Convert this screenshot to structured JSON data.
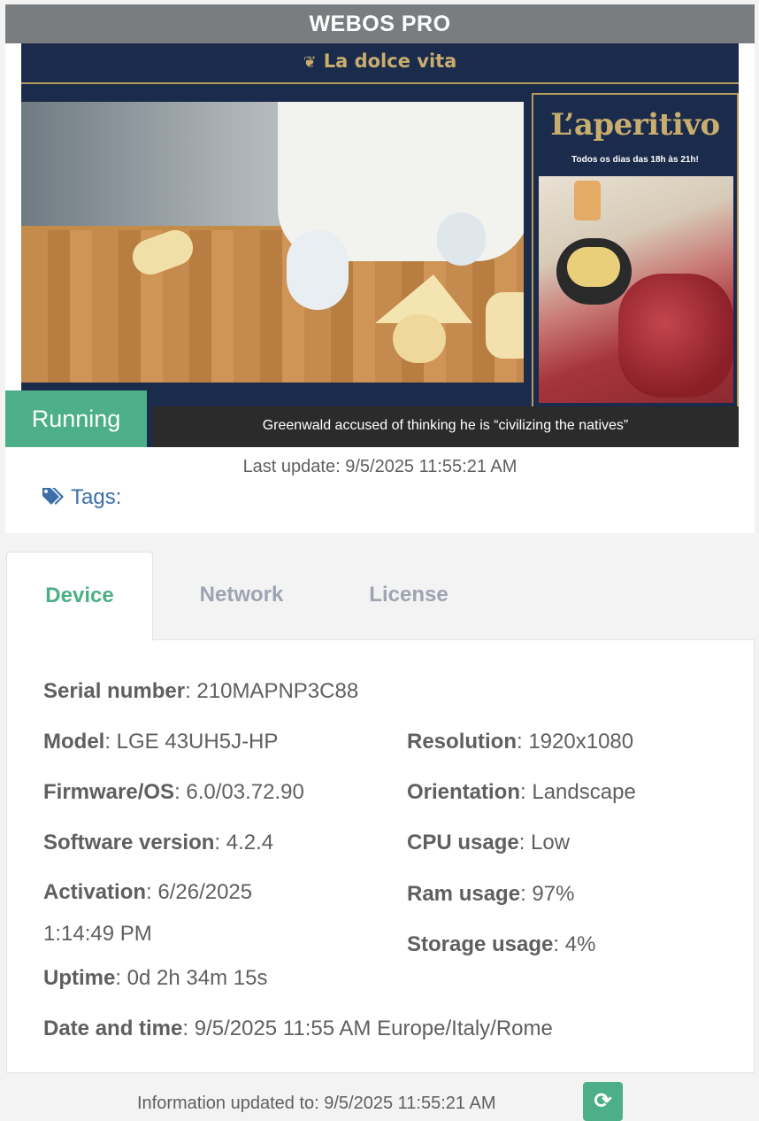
{
  "header": {
    "title": "WEBOS PRO"
  },
  "screen": {
    "brand": "La dolce vita",
    "poster_title": "L’aperitivo",
    "poster_subtitle": "Todos os dias das 18h às 21h!",
    "ticker": "Greenwald accused of thinking he is “civilizing the natives”"
  },
  "status": {
    "label": "Running",
    "color": "#4caf89"
  },
  "last_update": "Last update: 9/5/2025 11:55:21 AM",
  "tags": {
    "label": "Tags:"
  },
  "tabs": [
    {
      "label": "Device",
      "active": true
    },
    {
      "label": "Network",
      "active": false
    },
    {
      "label": "License",
      "active": false
    }
  ],
  "device": {
    "serial": {
      "label": "Serial number",
      "value": ": 210MAPNP3C88"
    },
    "model": {
      "label": "Model",
      "value": ": LGE 43UH5J-HP"
    },
    "firmware": {
      "label": "Firmware/OS",
      "value": ": 6.0/03.72.90"
    },
    "software": {
      "label": "Software version",
      "value": ": 4.2.4"
    },
    "activation": {
      "label": "Activation",
      "value": ": 6/26/2025 1:14:49 PM"
    },
    "uptime": {
      "label": "Uptime",
      "value": ": 0d 2h 34m 15s"
    },
    "datetime": {
      "label": "Date and time",
      "value": ": 9/5/2025 11:55 AM Europe/Italy/Rome"
    },
    "resolution": {
      "label": "Resolution",
      "value": ": 1920x1080"
    },
    "orientation": {
      "label": "Orientation",
      "value": ": Landscape"
    },
    "cpu": {
      "label": "CPU usage",
      "value": ": Low"
    },
    "ram": {
      "label": "Ram usage",
      "value": ": 97%"
    },
    "storage": {
      "label": "Storage usage",
      "value": ": 4%"
    }
  },
  "footer": {
    "info": "Information updated to: 9/5/2025 11:55:21 AM"
  },
  "icons": {
    "tag": "tag-icon",
    "refresh": "refresh-icon",
    "leaf": "leaf-icon"
  }
}
